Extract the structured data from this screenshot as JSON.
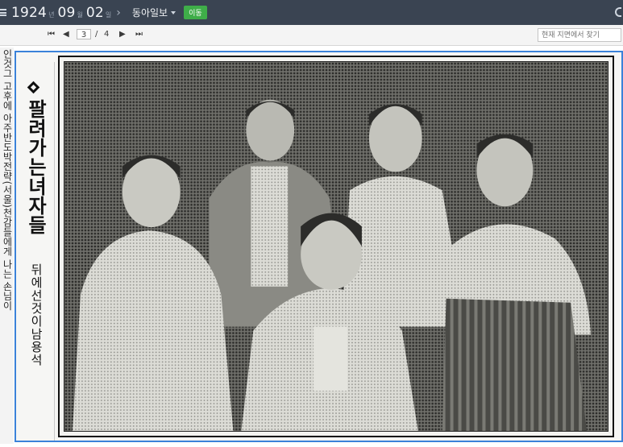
{
  "topbar": {
    "year": "1924",
    "year_unit": "년",
    "month": "09",
    "month_unit": "월",
    "day": "02",
    "day_unit": "일",
    "newspaper": "동아일보",
    "go_label": "이동"
  },
  "pager": {
    "current_page": "3",
    "separator": "/",
    "total_pages": "4",
    "search_placeholder": "현재 지면에서 찾기"
  },
  "article": {
    "left_column_text": "인것그 고후에 아주반도박전략(서울)천감들에게 나는 손님이",
    "headline": "팔려가는녀자들",
    "subline": "뒤에선것이남용석"
  },
  "colors": {
    "topbar_bg": "#3a4452",
    "go_button": "#3fae49",
    "selection_border": "#3b82d9"
  }
}
